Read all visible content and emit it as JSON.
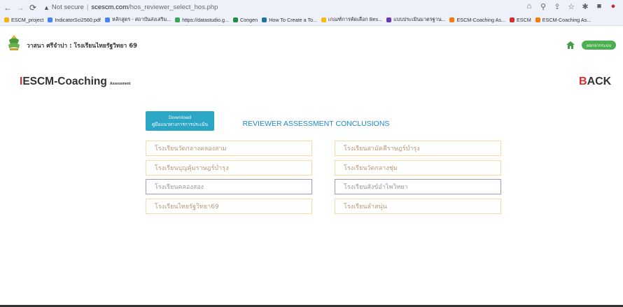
{
  "browser": {
    "not_secure": "Not secure",
    "url_domain": "scescm.com",
    "url_path": "/hos_reviewer_select_hos.php",
    "bookmarks": [
      {
        "label": "ESCM_project",
        "color": "#f4b400"
      },
      {
        "label": "IndicatorSci2560.pdf",
        "color": "#4285f4"
      },
      {
        "label": "หลักสูตร - สถาบันส่งเสริม...",
        "color": "#4285f4"
      },
      {
        "label": "https://datastudio.g...",
        "color": "#34a853"
      },
      {
        "label": "Congen",
        "color": "#1e8e3e"
      },
      {
        "label": "How To Create a To...",
        "color": "#21759b"
      },
      {
        "label": "เกณฑ์การคัดเลือก Bes...",
        "color": "#fbbc05"
      },
      {
        "label": "แบบประเมินมาตรฐาน...",
        "color": "#673ab7"
      },
      {
        "label": "ESCM-Coaching As...",
        "color": "#f57c00"
      },
      {
        "label": "ESCM",
        "color": "#d32f2f"
      },
      {
        "label": "ESCM-Coaching As...",
        "color": "#f57c00"
      }
    ]
  },
  "header": {
    "school_name": "วาสนา ศรีจำปา : โรงเรียนไทยรัฐวิทยา 69",
    "logout_label": "ออกจากระบบ"
  },
  "brand": {
    "first_letter": "I",
    "rest": "ESCM-Coaching",
    "sub": "Assessment"
  },
  "back": {
    "first_letter": "B",
    "rest": "ACK"
  },
  "page_title": "REVIEWER ASSESSMENT CONCLUSIONS",
  "download": {
    "line1": "Download",
    "line2": "คู่มือแนวทางการการประเมิน"
  },
  "schools": [
    "โรงเรียนวัดกลางคลองสาม",
    "โรงเรียนสามัคคีราษฎร์บำรุง",
    "โรงเรียนบุญคุ้มราษฎร์บำรุง",
    "โรงเรียนวัดกลางคลองสาม",
    "โรงเรียนคลองสอง",
    "โรงเรียนสังข์อำไพวิทยา",
    "โรงเรียนไทยรัฐวิทยา69",
    "โรงเรียนลำสนุ่น"
  ],
  "schools_display": [
    "โรงเรียนวัดกลางคลองสาม",
    "โรงเรียนสามัคคีราษฎร์บำรุง",
    "โรงเรียนบุญคุ้มราษฎร์บำรุง",
    "โรงเรียนวัดกลางชุ่ม",
    "โรงเรียนคลองสอง",
    "โรงเรียนสังข์อำไพวิทยา",
    "โรงเรียนไทยรัฐวิทยา69",
    "โรงเรียนลำสนุ่น"
  ],
  "colors": {
    "title": "#1e88c9",
    "download_bg": "#2ba6c4",
    "logout_bg": "#4caf50",
    "brand_red": "#d32f2f",
    "card_border": "#f2ddb0",
    "card_selected_border": "#9b9fbd"
  }
}
